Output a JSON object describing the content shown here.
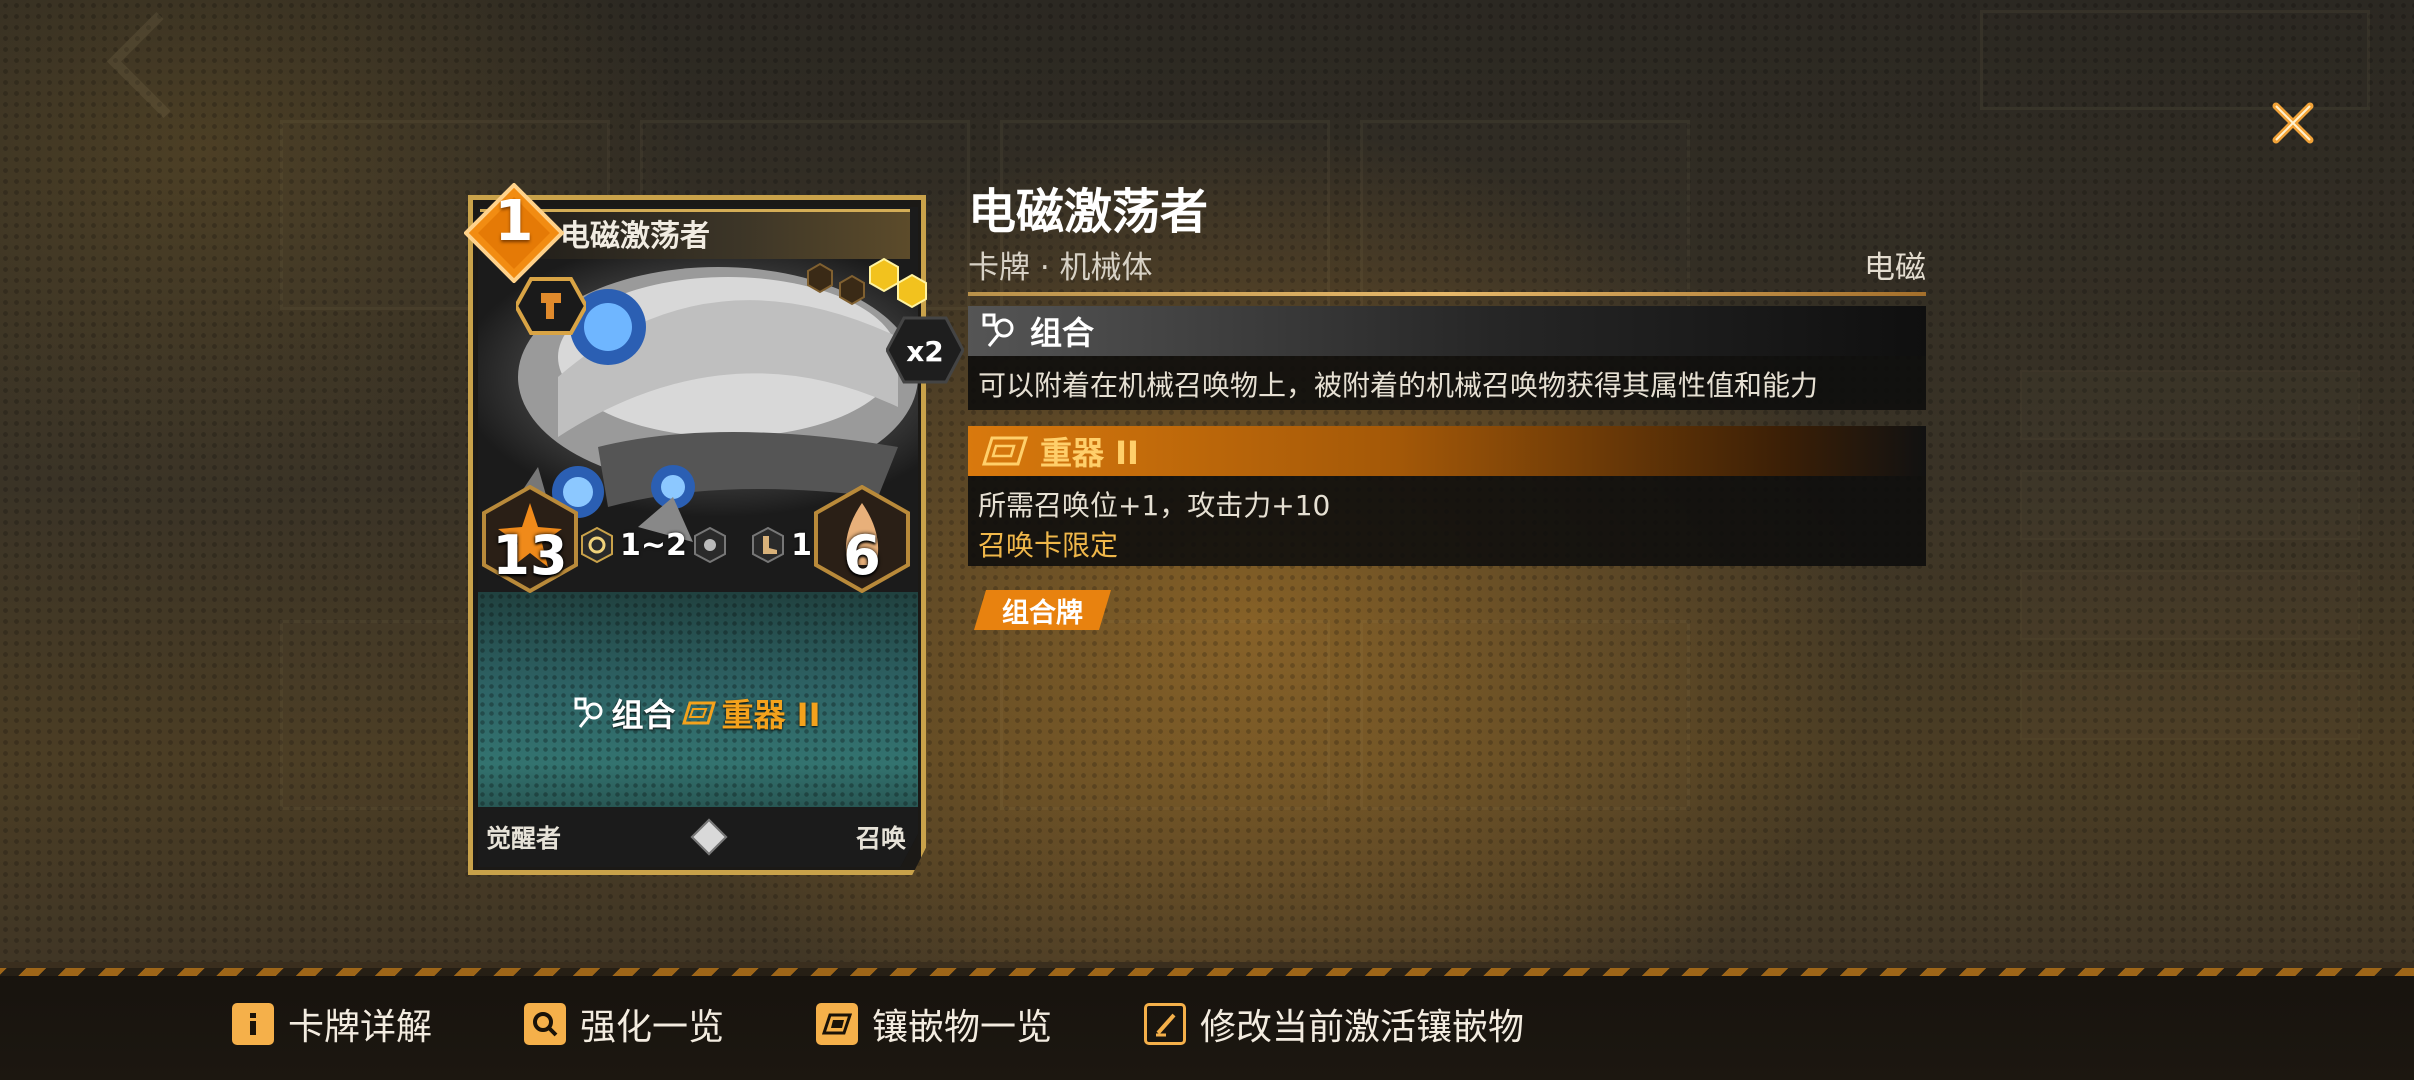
{
  "card": {
    "cost": "1",
    "name": "电磁激荡者",
    "copies": "x2",
    "attack": "13",
    "health": "6",
    "range": "1~2",
    "mini_stat": "1",
    "ability_label": "组合",
    "inlay_label": "重器 II",
    "footer_left": "觉醒者",
    "footer_right": "召唤"
  },
  "detail": {
    "title": "电磁激荡者",
    "subtitle": "卡牌 · 机械体",
    "element": "电磁",
    "abilities": [
      {
        "name": "组合",
        "icon": "combine-icon",
        "description": "可以附着在机械召唤物上，被附着的机械召唤物获得其属性值和能力"
      },
      {
        "name": "重器 II",
        "icon": "inlay-icon",
        "description": "所需召唤位+1，攻击力+10",
        "restriction": "召唤卡限定"
      }
    ],
    "tag": "组合牌"
  },
  "toolbar": {
    "items": [
      {
        "label": "卡牌详解",
        "icon": "info-icon"
      },
      {
        "label": "强化一览",
        "icon": "search-icon"
      },
      {
        "label": "镶嵌物一览",
        "icon": "inlay-icon"
      },
      {
        "label": "修改当前激活镶嵌物",
        "icon": "edit-icon"
      }
    ]
  },
  "colors": {
    "accent_orange": "#e8820f",
    "gold_frame": "#c9a24a",
    "restriction_text": "#f1b84a"
  }
}
